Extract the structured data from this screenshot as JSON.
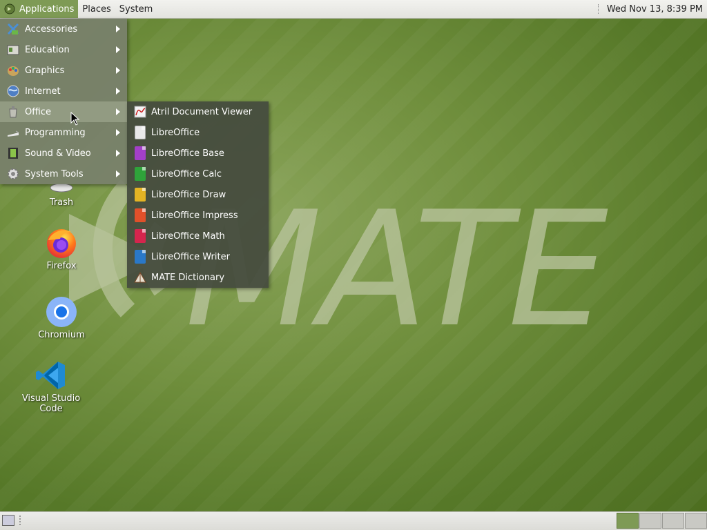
{
  "top_panel": {
    "menus": [
      {
        "label": "Applications",
        "icon": "mate-logo-icon",
        "active": true
      },
      {
        "label": "Places"
      },
      {
        "label": "System"
      }
    ],
    "clock": "Wed Nov 13,  8:39 PM"
  },
  "applications_menu": {
    "items": [
      {
        "label": "Accessories",
        "icon": "accessories-icon"
      },
      {
        "label": "Education",
        "icon": "education-icon"
      },
      {
        "label": "Graphics",
        "icon": "graphics-icon"
      },
      {
        "label": "Internet",
        "icon": "internet-globe-icon"
      },
      {
        "label": "Office",
        "icon": "office-icon",
        "selected": true
      },
      {
        "label": "Programming",
        "icon": "programming-icon"
      },
      {
        "label": "Sound & Video",
        "icon": "sound-video-icon"
      },
      {
        "label": "System Tools",
        "icon": "system-tools-icon"
      }
    ]
  },
  "office_submenu": {
    "items": [
      {
        "label": "Atril Document Viewer",
        "icon": "atril-icon"
      },
      {
        "label": "LibreOffice",
        "icon": "libreoffice-icon",
        "color": "#e8e8e8"
      },
      {
        "label": "LibreOffice Base",
        "icon": "libreoffice-base-icon",
        "color": "#a33fc8"
      },
      {
        "label": "LibreOffice Calc",
        "icon": "libreoffice-calc-icon",
        "color": "#2fa33a"
      },
      {
        "label": "LibreOffice Draw",
        "icon": "libreoffice-draw-icon",
        "color": "#e4b424"
      },
      {
        "label": "LibreOffice Impress",
        "icon": "libreoffice-impress-icon",
        "color": "#e0502a"
      },
      {
        "label": "LibreOffice Math",
        "icon": "libreoffice-math-icon",
        "color": "#d5254d"
      },
      {
        "label": "LibreOffice Writer",
        "icon": "libreoffice-writer-icon",
        "color": "#2a78c8"
      },
      {
        "label": "MATE Dictionary",
        "icon": "dictionary-icon"
      }
    ]
  },
  "desktop": {
    "logo_text": "MATE",
    "icons": [
      {
        "label": "Trash",
        "icon": "trash-icon"
      },
      {
        "label": "Firefox",
        "icon": "firefox-icon"
      },
      {
        "label": "Chromium",
        "icon": "chromium-icon"
      },
      {
        "label": "Visual Studio Code",
        "icon": "vscode-icon"
      }
    ]
  },
  "bottom_panel": {
    "workspaces": 4,
    "active_workspace": 1
  }
}
